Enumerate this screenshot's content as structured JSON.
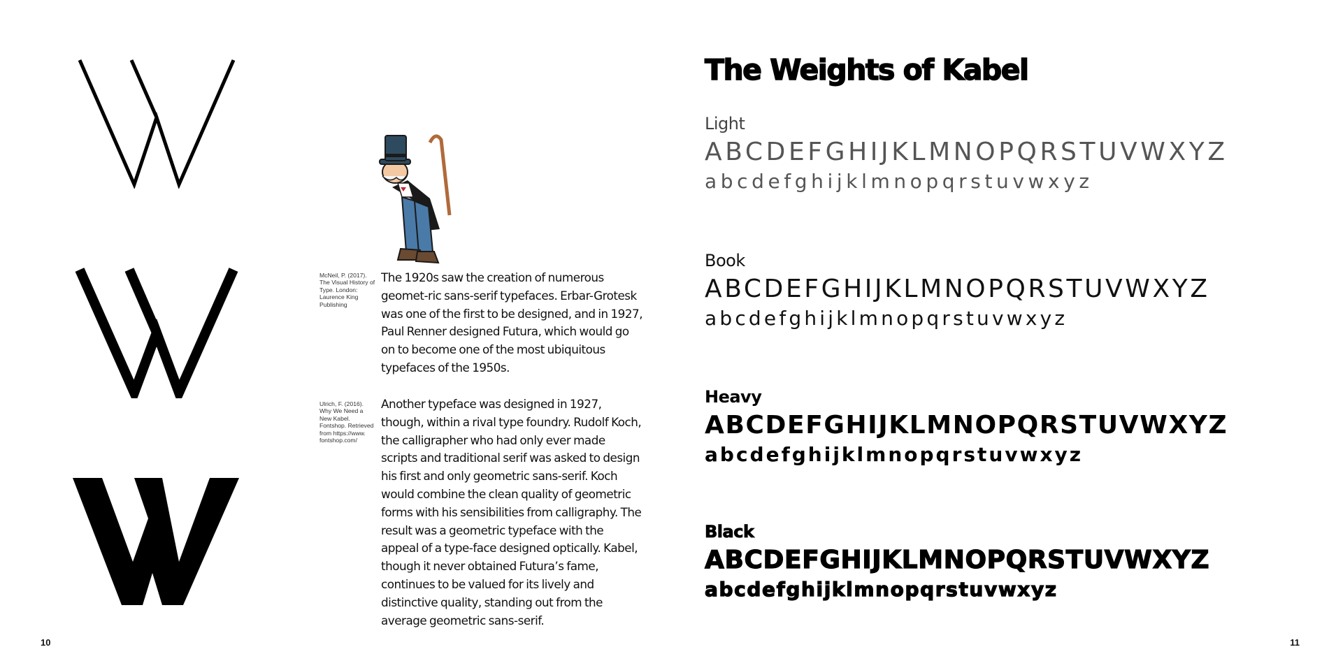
{
  "left_page": {
    "page_number": "10",
    "w_glyphs": [
      {
        "weight": "Light",
        "icon": "kabel-w-light-glyph"
      },
      {
        "weight": "Heavy",
        "icon": "kabel-w-heavy-glyph"
      },
      {
        "weight": "Black",
        "icon": "kabel-w-black-glyph"
      }
    ],
    "illustration": {
      "icon": "monopoly-man-mascot",
      "colors": {
        "hat": "#2e4a5e",
        "pants": "#4a7aa8",
        "bowtie": "#c8242a",
        "cane": "#b06a3a"
      }
    },
    "citations": [
      "McNeil, P. (2017). The Visual History of Type. London: Laurence King Publishing",
      "Ulrich, F. (2016). Why We Need a New Kabel. Fontshop. Retrieved from https://www. fontshop.com/"
    ],
    "paragraphs": [
      "The 1920s saw the creation of numerous geomet-ric sans-serif typefaces. Erbar-Grotesk was one of the first to be designed, and in 1927, Paul Renner designed Futura, which would go on to become one of the most ubiquitous typefaces of the 1950s.",
      "Another typeface was designed in 1927, though, within a rival type foundry. Rudolf Koch, the calligrapher who had only ever made scripts and traditional serif was asked to design his first and only geometric sans-serif. Koch would combine the clean quality of geometric forms with his sensibilities from calligraphy. The result was a geometric typeface with the appeal of a type-face designed optically.  Kabel, though it never obtained Futura’s fame, continues to be valued for its lively and distinctive quality, standing out from the average geometric sans-serif."
    ]
  },
  "right_page": {
    "page_number": "11",
    "title": "The Weights of Kabel",
    "weights": [
      {
        "name": "Light",
        "uppercase": "ABCDEFGHIJKLMNOPQRSTUVWXYZ",
        "lowercase": "abcdefghijklmnopqrstuvwxyz"
      },
      {
        "name": "Book",
        "uppercase": "ABCDEFGHIJKLMNOPQRSTUVWXYZ",
        "lowercase": "abcdefghijklmnopqrstuvwxyz"
      },
      {
        "name": "Heavy",
        "uppercase": "ABCDEFGHIJKLMNOPQRSTUVWXYZ",
        "lowercase": "abcdefghijklmnopqrstuvwxyz"
      },
      {
        "name": "Black",
        "uppercase": "ABCDEFGHIJKLMNOPQRSTUVWXYZ",
        "lowercase": "abcdefghijklmnopqrstuvwxyz"
      }
    ]
  },
  "colors": {
    "background": "#ffffff",
    "text": "#111111"
  }
}
